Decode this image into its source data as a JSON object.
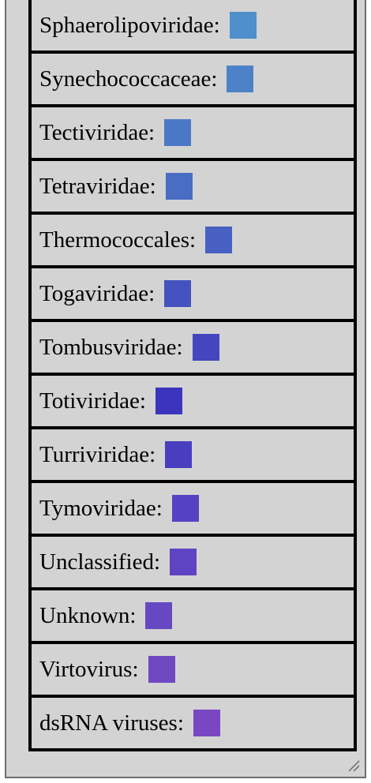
{
  "legend": {
    "items": [
      {
        "label": "Sphaerolipoviridae:",
        "color": "#4f8fcb"
      },
      {
        "label": "Synechococcaceae:",
        "color": "#4d82c8"
      },
      {
        "label": "Tectiviridae:",
        "color": "#4b78c6"
      },
      {
        "label": "Tetraviridae:",
        "color": "#4a6dc4"
      },
      {
        "label": "Thermococcales:",
        "color": "#4860c2"
      },
      {
        "label": "Togaviridae:",
        "color": "#4553c0"
      },
      {
        "label": "Tombusviridae:",
        "color": "#4346be"
      },
      {
        "label": "Totiviridae:",
        "color": "#3b35bd"
      },
      {
        "label": "Turriviridae:",
        "color": "#4a3ec0"
      },
      {
        "label": "Tymoviridae:",
        "color": "#5542c2"
      },
      {
        "label": "Unclassified:",
        "color": "#5e44c2"
      },
      {
        "label": "Unknown:",
        "color": "#6648c2"
      },
      {
        "label": "Virtovirus:",
        "color": "#6f48c2"
      },
      {
        "label": "dsRNA viruses:",
        "color": "#7a47c3"
      }
    ]
  }
}
